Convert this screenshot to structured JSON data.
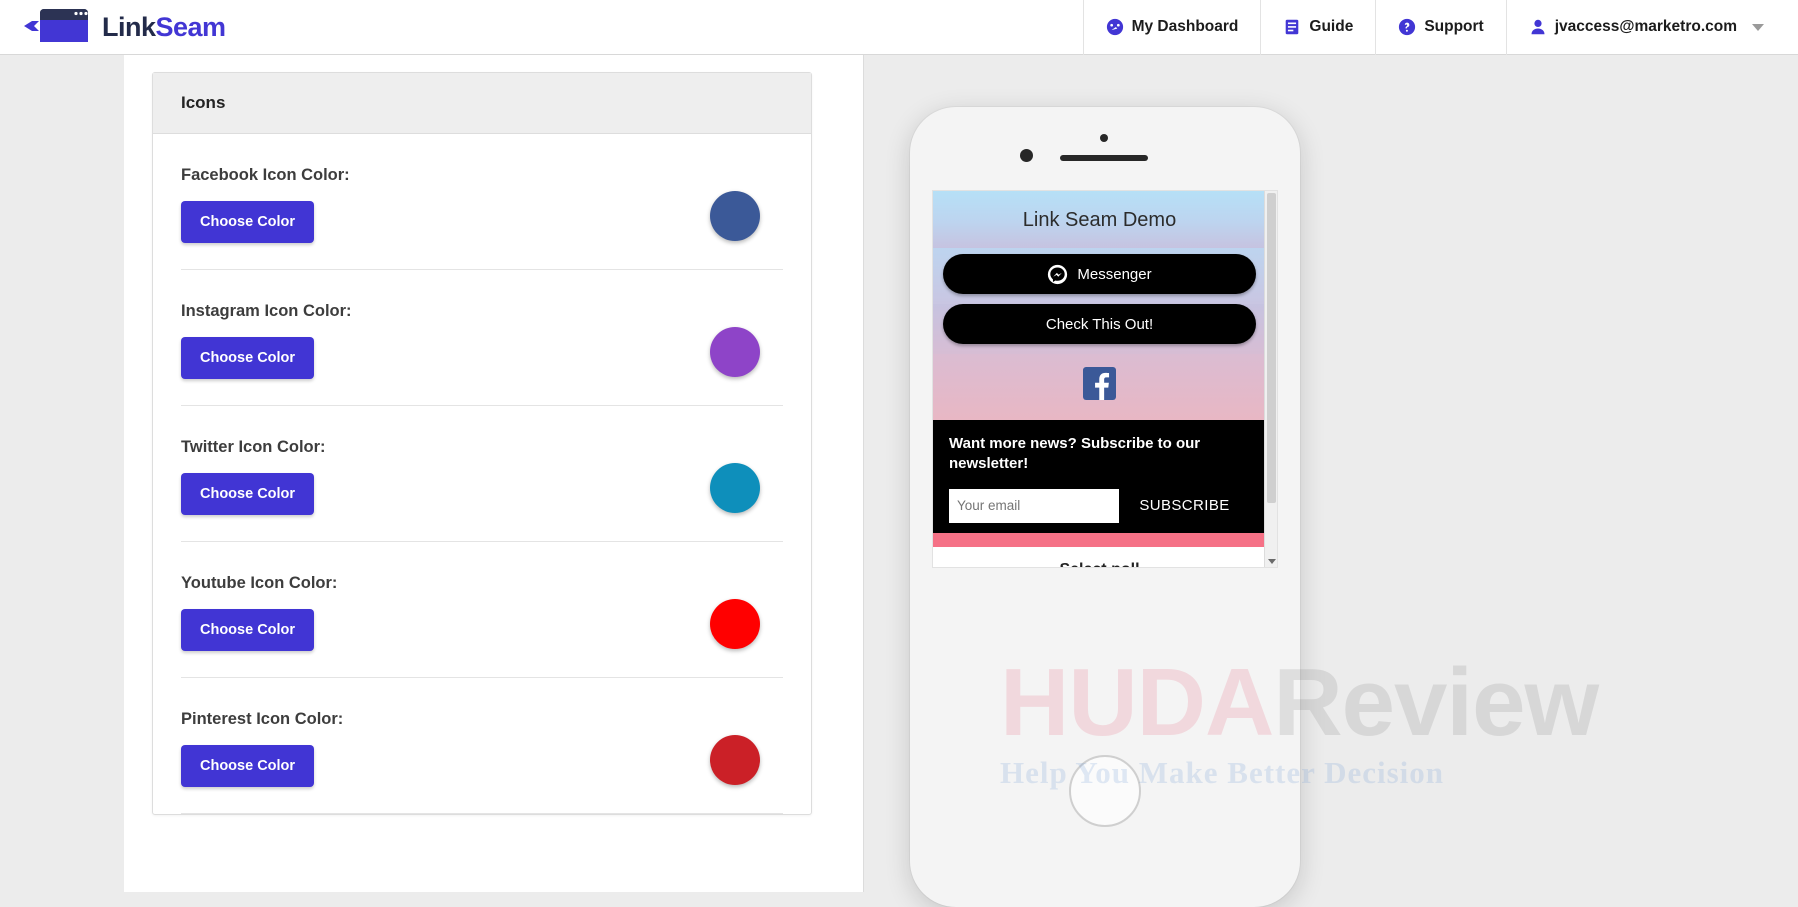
{
  "brand": {
    "part1": "Link",
    "part2": "Seam",
    "icon": "linkseam-logo-icon"
  },
  "nav": {
    "items": [
      {
        "label": "My Dashboard",
        "icon": "dashboard-icon"
      },
      {
        "label": "Guide",
        "icon": "book-icon"
      },
      {
        "label": "Support",
        "icon": "question-circle-icon"
      }
    ],
    "account": {
      "label": "jvaccess@marketro.com",
      "icon": "user-icon",
      "caret": "chevron-down-icon"
    }
  },
  "card": {
    "title": "Icons",
    "rows": [
      {
        "label": "Facebook Icon Color:",
        "button": "Choose Color",
        "color": "#3b5998"
      },
      {
        "label": "Instagram Icon Color:",
        "button": "Choose Color",
        "color": "#8e44c8"
      },
      {
        "label": "Twitter Icon Color:",
        "button": "Choose Color",
        "color": "#0e8fbb"
      },
      {
        "label": "Youtube Icon Color:",
        "button": "Choose Color",
        "color": "#ff0000"
      },
      {
        "label": "Pinterest Icon Color:",
        "button": "Choose Color",
        "color": "#cb2027"
      }
    ]
  },
  "preview": {
    "demo_title": "Link Seam Demo",
    "messenger_label": "Messenger",
    "messenger_icon": "messenger-icon",
    "cta_label": "Check This Out!",
    "facebook_icon": "facebook-icon",
    "newsletter_text": "Want more news? Subscribe to our newsletter!",
    "email_placeholder": "Your email",
    "email_value": "",
    "subscribe_label": "SUBSCRIBE",
    "poll_label": "Select poll",
    "scroll_arrow_icon": "scroll-down-arrow-icon"
  },
  "watermark": {
    "part1": "HUDA",
    "part2": "Review",
    "tagline": "Help You Make Better Decision"
  },
  "theme": {
    "accent": "#4135d4",
    "nav_icon": "#4236d4",
    "card_header_bg": "#eeeeee",
    "page_bg": "#ececec",
    "pink": "#f57186"
  }
}
